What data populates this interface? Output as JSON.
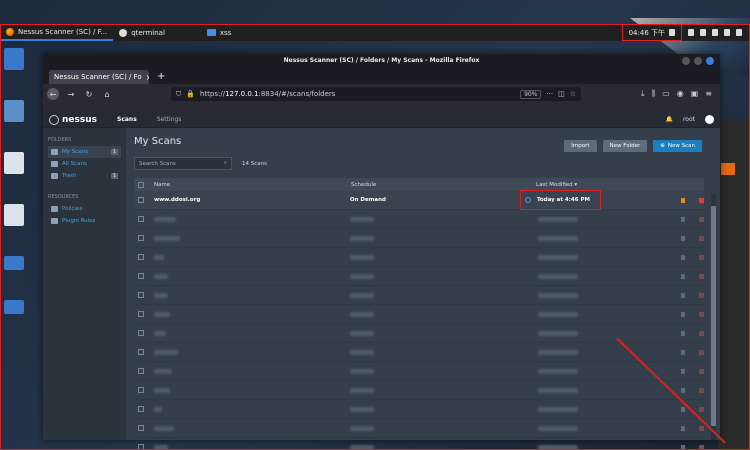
{
  "taskbar": {
    "items": [
      {
        "label": "Nessus Scanner (SC) / F...",
        "icon": "firefox-icon"
      },
      {
        "label": "qterminal",
        "icon": "terminal-icon"
      },
      {
        "label": "xss",
        "icon": "folder-icon"
      }
    ],
    "clock": "04:46 下午"
  },
  "browser": {
    "window_title": "Nessus Scanner (SC) / Folders / My Scans - Mozilla Firefox",
    "tab_label": "Nessus Scanner (SC) / Fo",
    "url_prefix": "https://",
    "url_host": "127.0.0.1",
    "url_rest": ":8834/#/scans/folders",
    "zoom": "90%",
    "new_tab": "+"
  },
  "nessus": {
    "logo": "nessus",
    "nav": [
      "Scans",
      "Settings"
    ],
    "user": "root",
    "sidebar": {
      "folders_heading": "FOLDERS",
      "folders": [
        {
          "label": "My Scans",
          "badge": "1"
        },
        {
          "label": "All Scans",
          "badge": ""
        },
        {
          "label": "Trash",
          "badge": "1"
        }
      ],
      "resources_heading": "RESOURCES",
      "resources": [
        {
          "label": "Policies"
        },
        {
          "label": "Plugin Rules"
        }
      ]
    },
    "main": {
      "title": "My Scans",
      "buttons": {
        "import": "Import",
        "new_folder": "New Folder",
        "new_scan": "New Scan"
      },
      "search_placeholder": "Search Scans",
      "count": "14 Scans",
      "columns": {
        "name": "Name",
        "schedule": "Schedule",
        "modified": "Last Modified ▾"
      },
      "first_row": {
        "name": "www.ddosi.org",
        "schedule": "On Demand",
        "modified": "Today at 4:46 PM"
      }
    }
  },
  "colors": {
    "accent": "#1b7fbf",
    "annotation": "#e02020"
  }
}
